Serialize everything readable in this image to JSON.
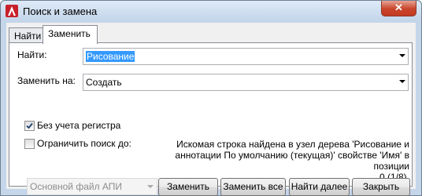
{
  "window": {
    "title": "Поиск и замена",
    "close_glyph": "✕"
  },
  "tabs": [
    {
      "label": "Найти",
      "active": false
    },
    {
      "label": "Заменить",
      "active": true
    }
  ],
  "find": {
    "label": "Найти:",
    "value": "Рисование"
  },
  "replace": {
    "label": "Заменить на:",
    "value": "Создать"
  },
  "options": {
    "case_insensitive": {
      "label": "Без учета регистра",
      "checked": true
    },
    "limit_search": {
      "label": "Ограничить поиск до:",
      "checked": false
    },
    "scope_value": "Основной файл АПИ"
  },
  "status_message": {
    "line1": "Искомая строка найдена в узел дерева 'Рисование и",
    "line2": "аннотации По умолчанию (текущая)' свойстве 'Имя' в позиции",
    "line3": "0 (1/8)."
  },
  "buttons": {
    "replace": "Заменить",
    "replace_all": "Заменить все",
    "find_next": "Найти далее",
    "close": "Закрыть"
  },
  "icons": {
    "app": "autocad-a-icon",
    "close": "close-icon",
    "dropdown": "chevron-down-icon",
    "check": "checkmark-icon"
  },
  "colors": {
    "selection": "#3399ff",
    "close_button": "#c8442b",
    "title_bar": "#c3d5ea"
  }
}
